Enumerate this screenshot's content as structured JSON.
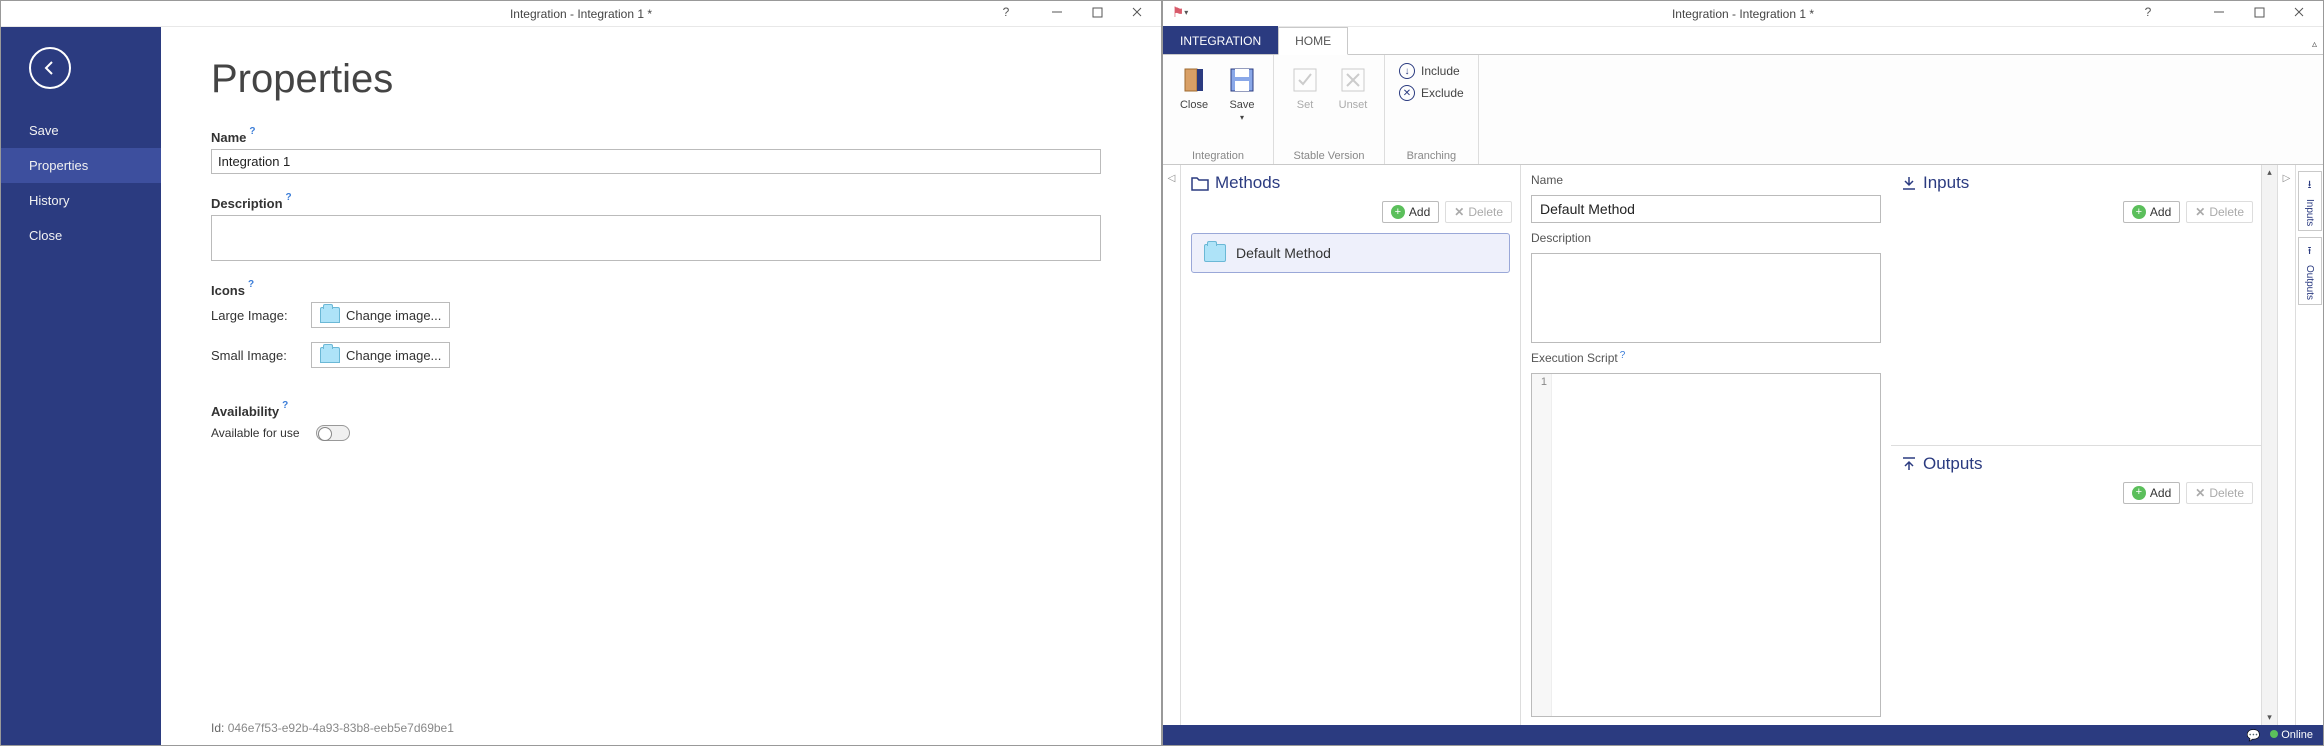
{
  "window1": {
    "title": "Integration - Integration 1 *",
    "sidebar": {
      "items": [
        "Save",
        "Properties",
        "History",
        "Close"
      ],
      "active_index": 1
    },
    "page_heading": "Properties",
    "name": {
      "label": "Name",
      "value": "Integration 1"
    },
    "description": {
      "label": "Description",
      "value": ""
    },
    "icons": {
      "label": "Icons",
      "large_label": "Large Image:",
      "small_label": "Small Image:",
      "change_button": "Change image..."
    },
    "availability": {
      "label": "Availability",
      "toggle_label": "Available for use",
      "value": false
    },
    "footer": {
      "id_label": "Id:",
      "id_value": "046e7f53-e92b-4a93-83b8-eeb5e7d69be1"
    }
  },
  "window2": {
    "title": "Integration - Integration 1 *",
    "tabs": {
      "integration": "INTEGRATION",
      "home": "HOME"
    },
    "ribbon": {
      "integration": {
        "close": "Close",
        "save": "Save",
        "group": "Integration"
      },
      "stable": {
        "set": "Set",
        "unset": "Unset",
        "group": "Stable Version"
      },
      "branching": {
        "include": "Include",
        "exclude": "Exclude",
        "group": "Branching"
      }
    },
    "methods": {
      "heading": "Methods",
      "add": "Add",
      "delete": "Delete",
      "items": [
        "Default Method"
      ]
    },
    "center": {
      "name_label": "Name",
      "name_value": "Default Method",
      "description_label": "Description",
      "description_value": "",
      "exec_label": "Execution Script",
      "line_number": "1"
    },
    "inputs": {
      "heading": "Inputs",
      "add": "Add",
      "delete": "Delete"
    },
    "outputs": {
      "heading": "Outputs",
      "add": "Add",
      "delete": "Delete"
    },
    "side_tabs": {
      "inputs": "Inputs",
      "outputs": "Outputs"
    },
    "status": {
      "online": "Online"
    }
  }
}
